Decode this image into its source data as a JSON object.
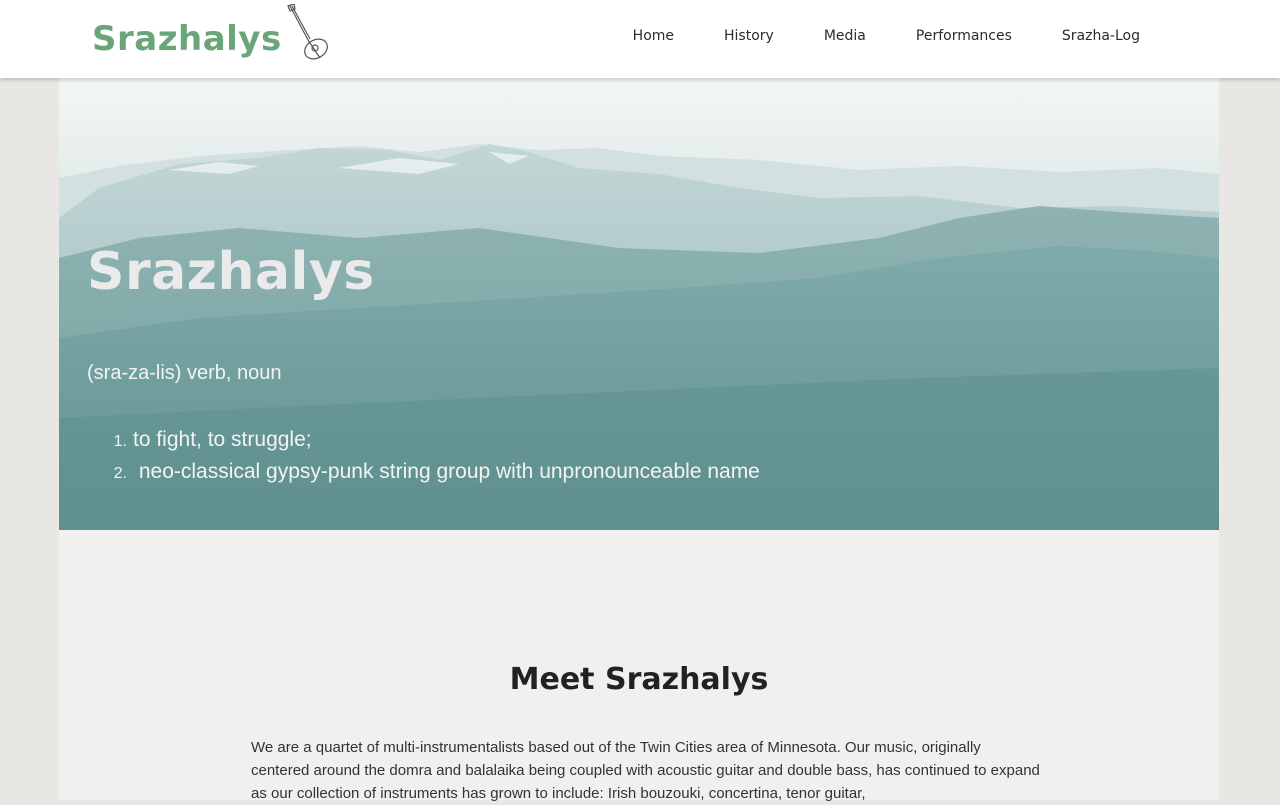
{
  "header": {
    "logo_text": "Srazhalys",
    "logo_icon": "balalaika-icon",
    "nav": [
      {
        "label": "Home"
      },
      {
        "label": "History"
      },
      {
        "label": "Media"
      },
      {
        "label": "Performances"
      },
      {
        "label": "Srazha-Log"
      }
    ]
  },
  "hero": {
    "title": "Srazhalys",
    "definition": "(sra-za-lis) verb, noun",
    "meanings": [
      {
        "num": "1.",
        "text": "to fight, to struggle;"
      },
      {
        "num": "2.",
        "text": " neo-classical gypsy-punk string group with unpronounceable name"
      }
    ]
  },
  "meet": {
    "title": "Meet Srazhalys",
    "body": "We are a quartet of multi-instrumentalists based out of the Twin Cities area of Minnesota. Our music, originally centered around the domra and balalaika being coupled with acoustic guitar and double bass, has continued to expand as our collection of instruments has grown to include: Irish bouzouki, concertina, tenor guitar,"
  },
  "colors": {
    "brand": "#6aa57a",
    "hero_tint": "#7aa9a8",
    "page_bg": "#f0f0f0",
    "outer_bg": "#e8e7e3"
  }
}
